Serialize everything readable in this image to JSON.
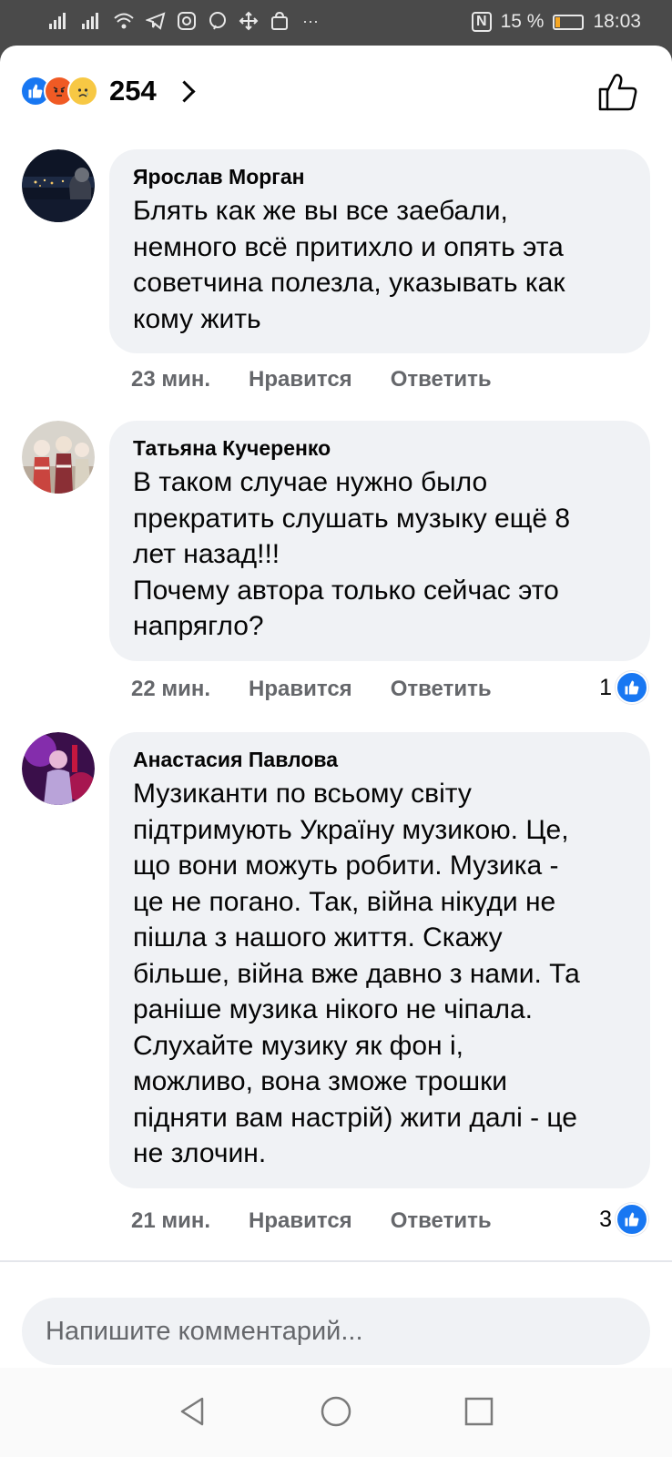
{
  "status_bar": {
    "nfc": "N",
    "battery_percent": "15 %",
    "battery_level": 0.15,
    "time": "18:03",
    "overflow": "···"
  },
  "reactions": {
    "count": "254",
    "icons": [
      "like-icon",
      "angry-emoji-icon",
      "sad-emoji-icon"
    ]
  },
  "comments": [
    {
      "author": "Ярослав Морган",
      "text": "Блять как же вы все заебали,\nнемного всё притихло и опять эта\nсоветчина полезла, указывать как\nкому жить",
      "time": "23 мин.",
      "like_label": "Нравится",
      "reply_label": "Ответить",
      "likes": ""
    },
    {
      "author": "Татьяна Кучеренко",
      "text": "В таком случае нужно было\nпрекратить слушать музыку ещё 8\nлет назад!!!\nПочему автора только сейчас это\nнапрягло?",
      "time": "22 мин.",
      "like_label": "Нравится",
      "reply_label": "Ответить",
      "likes": "1"
    },
    {
      "author": "Анастасия Павлова",
      "text": "Музиканти по всьому світу\nпідтримують Україну музикою. Це,\nщо вони можуть робити. Музика -\nце не погано. Так, війна нікуди не\nпішла з нашого життя. Скажу\nбільше, війна вже давно з нами. Та\nраніше музика нікого не чіпала.\nСлухайте музику як фон і,\nможливо, вона зможе трошки\nпідняти вам настрій) жити далі - це\nне злочин.",
      "time": "21 мин.",
      "like_label": "Нравится",
      "reply_label": "Ответить",
      "likes": "3"
    }
  ],
  "composer": {
    "placeholder": "Напишите комментарий..."
  },
  "colors": {
    "like_blue": "#1877f2",
    "bubble_bg": "#f0f2f5",
    "meta_gray": "#65676b"
  }
}
